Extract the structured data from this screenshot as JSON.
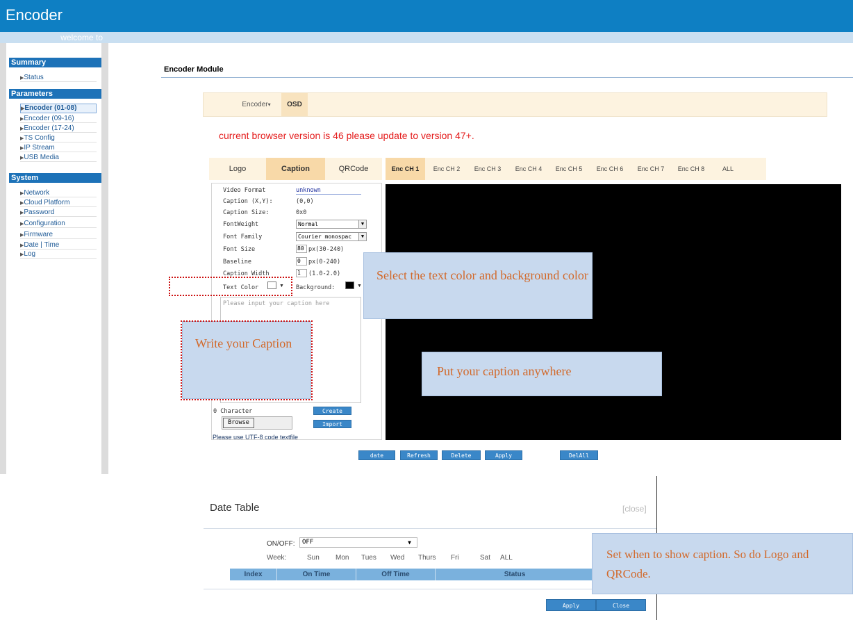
{
  "app": {
    "title": "Encoder",
    "welcome": "welcome to"
  },
  "sidebar": {
    "summary": {
      "header": "Summary",
      "items": [
        "Status"
      ]
    },
    "parameters": {
      "header": "Parameters",
      "items": [
        "Encoder (01-08)",
        "Encoder (09-16)",
        "Encoder (17-24)",
        "TS Config",
        "IP Stream",
        "USB Media"
      ]
    },
    "system": {
      "header": "System",
      "items": [
        "Network",
        "Cloud Platform",
        "Password",
        "Configuration",
        "Firmware",
        "Date | Time",
        "Log"
      ]
    }
  },
  "main": {
    "module_title": "Encoder Module",
    "tabs": {
      "encoder": "Encoder",
      "encoder_arrow": "▾",
      "osd": "OSD"
    },
    "warning": "current browser version is 46 please update to version 47+.",
    "osd_tabs": [
      "Logo",
      "Caption",
      "QRCode"
    ],
    "channels": [
      "Enc CH 1",
      "Enc CH 2",
      "Enc CH 3",
      "Enc CH 4",
      "Enc CH 5",
      "Enc CH 6",
      "Enc CH 7",
      "Enc CH 8",
      "ALL"
    ]
  },
  "caption": {
    "video_format_label": "Video Format",
    "video_format_value": "unknown",
    "xy_label": "Caption (X,Y):",
    "xy_value": "(0,0)",
    "size_label": "Caption Size:",
    "size_value": "0x0",
    "fontweight_label": "FontWeight",
    "fontweight_value": "Normal",
    "fontfamily_label": "Font Family",
    "fontfamily_value": "Courier monospac",
    "fontsize_label": "Font Size",
    "fontsize_value": "80",
    "fontsize_unit": "px(30-240)",
    "baseline_label": "Baseline",
    "baseline_value": "0",
    "baseline_unit": "px(0-240)",
    "width_label": "Caption Width",
    "width_value": "1",
    "width_unit": "(1.0-2.0)",
    "textcolor_label": "Text Color",
    "background_label": "Background:",
    "text_color": "#ffffff",
    "background_color": "#000000",
    "placeholder": "Please input your caption here",
    "char_count": "0 Character",
    "create": "Create",
    "browse": "Browse",
    "import": "Import",
    "utf_note": "Please use UTF-8 code textfile"
  },
  "bottom_buttons": [
    "date",
    "Refresh",
    "Delete",
    "Apply",
    "DelAll"
  ],
  "notes": {
    "color": "Select the text color and background color",
    "write": "Write your Caption",
    "put": "Put your caption anywhere",
    "set": "Set when to show caption. So do Logo and QRCode."
  },
  "date_table": {
    "title": "Date Table",
    "close_link": "[close]",
    "onoff_label": "ON/OFF:",
    "onoff_value": "OFF",
    "week_label": "Week:",
    "days": [
      "Sun",
      "Mon",
      "Tues",
      "Wed",
      "Thurs",
      "Fri",
      "Sat",
      "ALL"
    ],
    "columns": [
      "Index",
      "On Time",
      "Off Time",
      "Status"
    ],
    "apply": "Apply",
    "close": "Close"
  }
}
